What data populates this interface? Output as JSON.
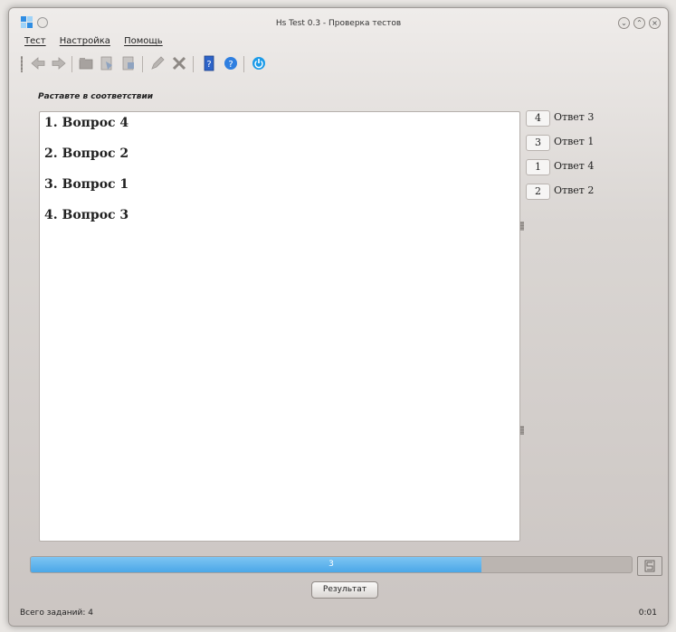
{
  "window": {
    "title": "Hs Test 0.3 - Проверка тестов"
  },
  "menu": [
    "Тест",
    "Настройка",
    "Помощь"
  ],
  "toolbar": {
    "icons": [
      "back-icon",
      "forward-icon",
      "folder-icon",
      "save-icon",
      "save-as-icon",
      "edit-icon",
      "tools-icon",
      "book-icon",
      "help-icon",
      "quit-icon"
    ]
  },
  "content": {
    "instruction": "Раставте в соответствии",
    "questions": [
      "1. Вопрос 4",
      "2. Вопрос 2",
      "3. Вопрос 1",
      "4. Вопрос 3"
    ],
    "answers": [
      {
        "number": "4",
        "label": "Ответ 3"
      },
      {
        "number": "3",
        "label": "Ответ 1"
      },
      {
        "number": "1",
        "label": "Ответ 4"
      },
      {
        "number": "2",
        "label": "Ответ 2"
      }
    ]
  },
  "progress": {
    "current": "3",
    "fraction": 0.75
  },
  "buttons": {
    "result": "Результат"
  },
  "status": {
    "total": "Всего заданий:  4",
    "time": "0:01"
  },
  "colors": {
    "accent": "#4aa7e8"
  }
}
